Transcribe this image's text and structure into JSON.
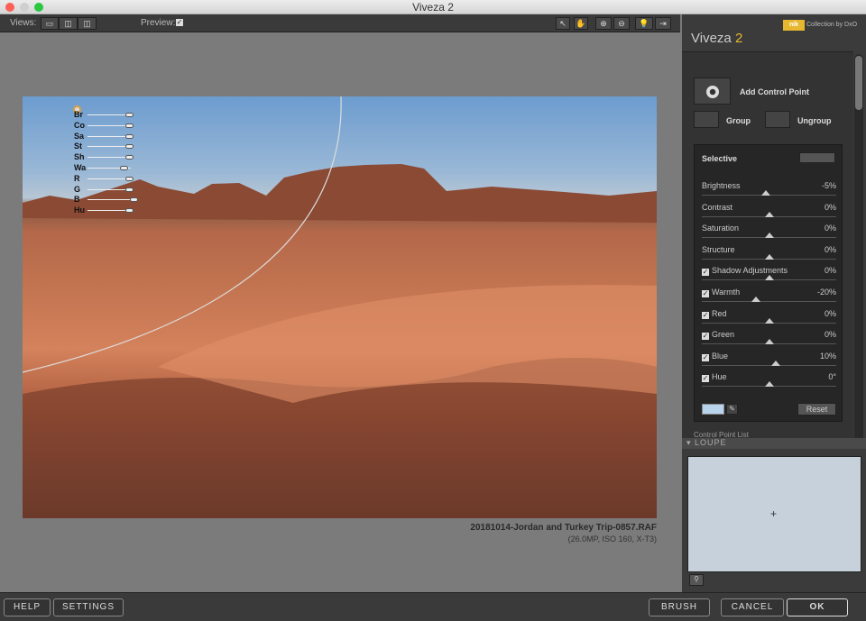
{
  "window": {
    "title": "Viveza 2"
  },
  "toolbar": {
    "views_label": "Views:",
    "preview_label": "Preview:",
    "preview_checked": true
  },
  "image": {
    "filename": "20181014-Jordan and Turkey Trip-0857.RAF",
    "info": "(26.0MP, ISO 160, X-T3)"
  },
  "overlay": {
    "labels": [
      "Br",
      "Co",
      "Sa",
      "St",
      "Sh",
      "Wa",
      "R",
      "G",
      "B",
      "Hu"
    ]
  },
  "sidebar": {
    "brand": "Collection by DxO",
    "brand_badge": "nik",
    "product": "Viveza",
    "version": "2",
    "add_control_point": "Add Control Point",
    "group": "Group",
    "ungroup": "Ungroup",
    "selective": "Selective",
    "sliders": [
      {
        "label": "Brightness",
        "value": "-5%",
        "num": -5,
        "checkbox": false
      },
      {
        "label": "Contrast",
        "value": "0%",
        "num": 0,
        "checkbox": false
      },
      {
        "label": "Saturation",
        "value": "0%",
        "num": 0,
        "checkbox": false
      },
      {
        "label": "Structure",
        "value": "0%",
        "num": 0,
        "checkbox": false
      },
      {
        "label": "Shadow Adjustments",
        "value": "0%",
        "num": 0,
        "checkbox": true
      },
      {
        "label": "Warmth",
        "value": "-20%",
        "num": -20,
        "checkbox": true
      },
      {
        "label": "Red",
        "value": "0%",
        "num": 0,
        "checkbox": true
      },
      {
        "label": "Green",
        "value": "0%",
        "num": 0,
        "checkbox": true
      },
      {
        "label": "Blue",
        "value": "10%",
        "num": 10,
        "checkbox": true
      },
      {
        "label": "Hue",
        "value": "0°",
        "num": 0,
        "checkbox": true
      }
    ],
    "swatch_color": "#b8d4ec",
    "reset": "Reset",
    "control_point_list": "Control Point List",
    "loupe": "LOUPE"
  },
  "footer": {
    "help": "HELP",
    "settings": "SETTINGS",
    "brush": "BRUSH",
    "cancel": "CANCEL",
    "ok": "OK"
  },
  "colors": {
    "accent": "#e8b730"
  }
}
